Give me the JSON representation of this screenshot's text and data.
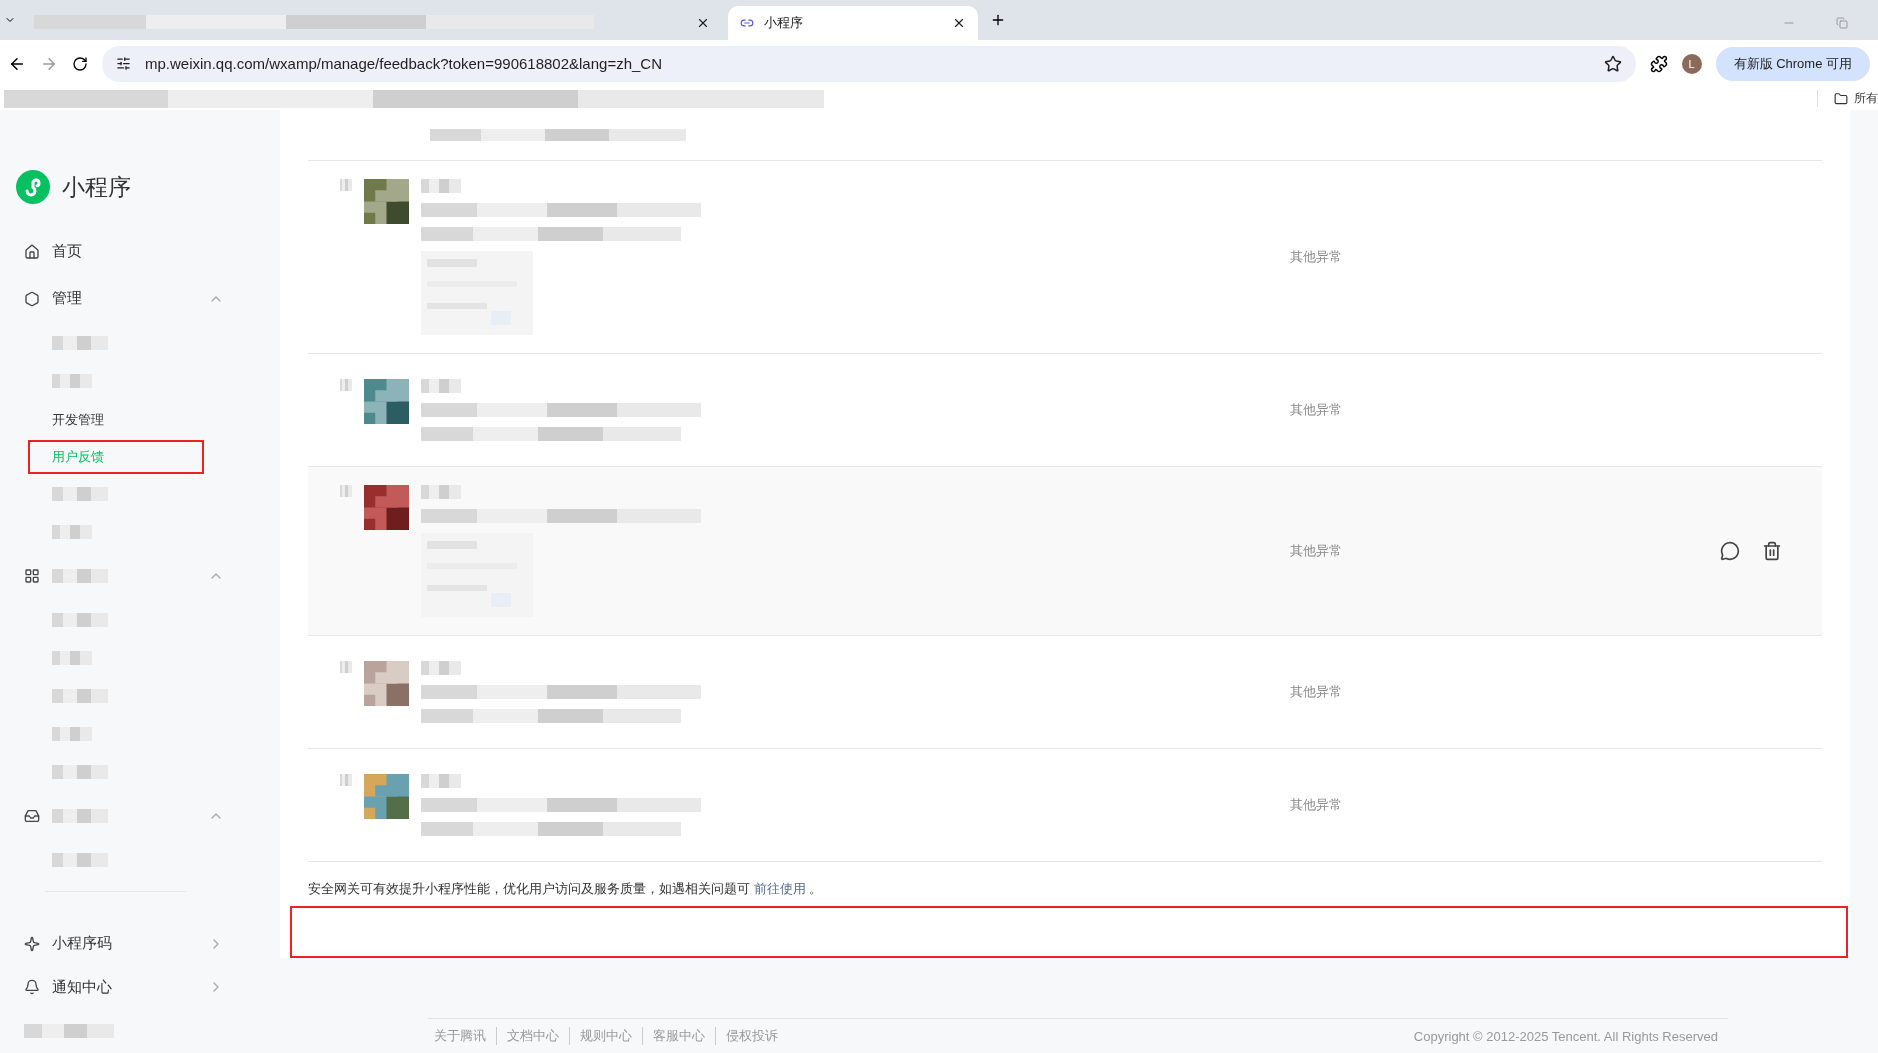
{
  "browser": {
    "tabs": [
      {
        "kind": "blurred",
        "selected": false
      },
      {
        "kind": "page",
        "title": "小程序",
        "selected": true
      }
    ],
    "url": "mp.weixin.qq.com/wxamp/manage/feedback?token=990618802&lang=zh_CN",
    "profile_initial": "L",
    "update_button": "有新版 Chrome 可用",
    "bookmark_folder": "所有"
  },
  "sidebar": {
    "app_name": "小程序",
    "items": [
      {
        "kind": "link",
        "label": "首页"
      },
      {
        "kind": "group",
        "label": "管理",
        "expanded": true,
        "children": [
          {
            "kind": "blurred"
          },
          {
            "kind": "blurred"
          },
          {
            "kind": "link",
            "label": "开发管理",
            "selected": false,
            "outlined": false
          },
          {
            "kind": "link",
            "label": "用户反馈",
            "selected": true,
            "outlined": true
          },
          {
            "kind": "blurred"
          },
          {
            "kind": "blurred"
          }
        ]
      },
      {
        "kind": "group",
        "expanded": true,
        "children": [
          {
            "kind": "blurred"
          },
          {
            "kind": "blurred"
          },
          {
            "kind": "blurred"
          },
          {
            "kind": "blurred"
          },
          {
            "kind": "blurred"
          }
        ]
      },
      {
        "kind": "group",
        "expanded": true,
        "children": [
          {
            "kind": "blurred"
          }
        ]
      },
      {
        "kind": "divider"
      },
      {
        "kind": "nav",
        "label": "小程序码"
      },
      {
        "kind": "nav",
        "label": "通知中心"
      },
      {
        "kind": "blurred"
      }
    ]
  },
  "feedback": {
    "rows": [
      {
        "status": "其他异常",
        "has_image": true,
        "hovered": false
      },
      {
        "status": "其他异常",
        "has_image": false,
        "hovered": false
      },
      {
        "status": "其他异常",
        "has_image": true,
        "hovered": true
      },
      {
        "status": "其他异常",
        "has_image": false,
        "hovered": false
      },
      {
        "status": "其他异常",
        "has_image": false,
        "hovered": false
      }
    ],
    "notice": {
      "text": "安全网关可有效提升小程序性能，优化用户访问及服务质量，如遇相关问题可",
      "link": "前往使用",
      "end": "。"
    },
    "empty_area_outlined": true
  },
  "footer": {
    "links": [
      "关于腾讯",
      "文档中心",
      "规则中心",
      "客服中心",
      "侵权投诉"
    ],
    "copyright": "Copyright © 2012-2025 Tencent. All Rights Reserved"
  }
}
